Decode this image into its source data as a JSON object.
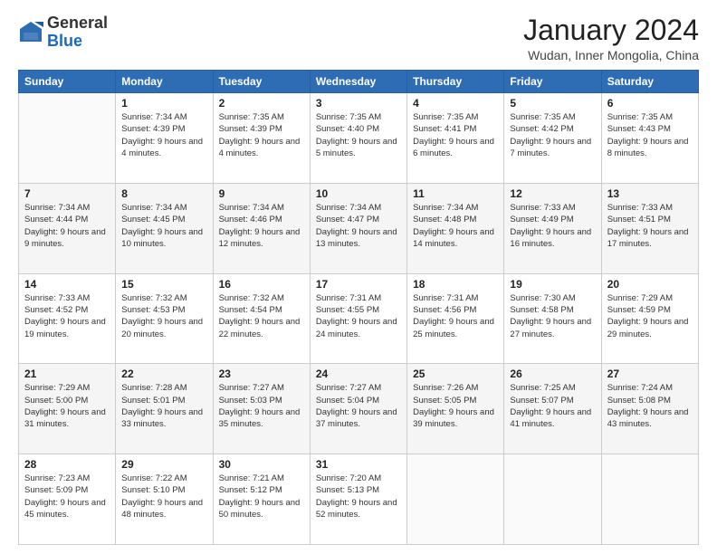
{
  "logo": {
    "general": "General",
    "blue": "Blue"
  },
  "header": {
    "month": "January 2024",
    "location": "Wudan, Inner Mongolia, China"
  },
  "weekdays": [
    "Sunday",
    "Monday",
    "Tuesday",
    "Wednesday",
    "Thursday",
    "Friday",
    "Saturday"
  ],
  "weeks": [
    [
      {
        "day": "",
        "sunrise": "",
        "sunset": "",
        "daylight": ""
      },
      {
        "day": "1",
        "sunrise": "Sunrise: 7:34 AM",
        "sunset": "Sunset: 4:39 PM",
        "daylight": "Daylight: 9 hours and 4 minutes."
      },
      {
        "day": "2",
        "sunrise": "Sunrise: 7:35 AM",
        "sunset": "Sunset: 4:39 PM",
        "daylight": "Daylight: 9 hours and 4 minutes."
      },
      {
        "day": "3",
        "sunrise": "Sunrise: 7:35 AM",
        "sunset": "Sunset: 4:40 PM",
        "daylight": "Daylight: 9 hours and 5 minutes."
      },
      {
        "day": "4",
        "sunrise": "Sunrise: 7:35 AM",
        "sunset": "Sunset: 4:41 PM",
        "daylight": "Daylight: 9 hours and 6 minutes."
      },
      {
        "day": "5",
        "sunrise": "Sunrise: 7:35 AM",
        "sunset": "Sunset: 4:42 PM",
        "daylight": "Daylight: 9 hours and 7 minutes."
      },
      {
        "day": "6",
        "sunrise": "Sunrise: 7:35 AM",
        "sunset": "Sunset: 4:43 PM",
        "daylight": "Daylight: 9 hours and 8 minutes."
      }
    ],
    [
      {
        "day": "7",
        "sunrise": "Sunrise: 7:34 AM",
        "sunset": "Sunset: 4:44 PM",
        "daylight": "Daylight: 9 hours and 9 minutes."
      },
      {
        "day": "8",
        "sunrise": "Sunrise: 7:34 AM",
        "sunset": "Sunset: 4:45 PM",
        "daylight": "Daylight: 9 hours and 10 minutes."
      },
      {
        "day": "9",
        "sunrise": "Sunrise: 7:34 AM",
        "sunset": "Sunset: 4:46 PM",
        "daylight": "Daylight: 9 hours and 12 minutes."
      },
      {
        "day": "10",
        "sunrise": "Sunrise: 7:34 AM",
        "sunset": "Sunset: 4:47 PM",
        "daylight": "Daylight: 9 hours and 13 minutes."
      },
      {
        "day": "11",
        "sunrise": "Sunrise: 7:34 AM",
        "sunset": "Sunset: 4:48 PM",
        "daylight": "Daylight: 9 hours and 14 minutes."
      },
      {
        "day": "12",
        "sunrise": "Sunrise: 7:33 AM",
        "sunset": "Sunset: 4:49 PM",
        "daylight": "Daylight: 9 hours and 16 minutes."
      },
      {
        "day": "13",
        "sunrise": "Sunrise: 7:33 AM",
        "sunset": "Sunset: 4:51 PM",
        "daylight": "Daylight: 9 hours and 17 minutes."
      }
    ],
    [
      {
        "day": "14",
        "sunrise": "Sunrise: 7:33 AM",
        "sunset": "Sunset: 4:52 PM",
        "daylight": "Daylight: 9 hours and 19 minutes."
      },
      {
        "day": "15",
        "sunrise": "Sunrise: 7:32 AM",
        "sunset": "Sunset: 4:53 PM",
        "daylight": "Daylight: 9 hours and 20 minutes."
      },
      {
        "day": "16",
        "sunrise": "Sunrise: 7:32 AM",
        "sunset": "Sunset: 4:54 PM",
        "daylight": "Daylight: 9 hours and 22 minutes."
      },
      {
        "day": "17",
        "sunrise": "Sunrise: 7:31 AM",
        "sunset": "Sunset: 4:55 PM",
        "daylight": "Daylight: 9 hours and 24 minutes."
      },
      {
        "day": "18",
        "sunrise": "Sunrise: 7:31 AM",
        "sunset": "Sunset: 4:56 PM",
        "daylight": "Daylight: 9 hours and 25 minutes."
      },
      {
        "day": "19",
        "sunrise": "Sunrise: 7:30 AM",
        "sunset": "Sunset: 4:58 PM",
        "daylight": "Daylight: 9 hours and 27 minutes."
      },
      {
        "day": "20",
        "sunrise": "Sunrise: 7:29 AM",
        "sunset": "Sunset: 4:59 PM",
        "daylight": "Daylight: 9 hours and 29 minutes."
      }
    ],
    [
      {
        "day": "21",
        "sunrise": "Sunrise: 7:29 AM",
        "sunset": "Sunset: 5:00 PM",
        "daylight": "Daylight: 9 hours and 31 minutes."
      },
      {
        "day": "22",
        "sunrise": "Sunrise: 7:28 AM",
        "sunset": "Sunset: 5:01 PM",
        "daylight": "Daylight: 9 hours and 33 minutes."
      },
      {
        "day": "23",
        "sunrise": "Sunrise: 7:27 AM",
        "sunset": "Sunset: 5:03 PM",
        "daylight": "Daylight: 9 hours and 35 minutes."
      },
      {
        "day": "24",
        "sunrise": "Sunrise: 7:27 AM",
        "sunset": "Sunset: 5:04 PM",
        "daylight": "Daylight: 9 hours and 37 minutes."
      },
      {
        "day": "25",
        "sunrise": "Sunrise: 7:26 AM",
        "sunset": "Sunset: 5:05 PM",
        "daylight": "Daylight: 9 hours and 39 minutes."
      },
      {
        "day": "26",
        "sunrise": "Sunrise: 7:25 AM",
        "sunset": "Sunset: 5:07 PM",
        "daylight": "Daylight: 9 hours and 41 minutes."
      },
      {
        "day": "27",
        "sunrise": "Sunrise: 7:24 AM",
        "sunset": "Sunset: 5:08 PM",
        "daylight": "Daylight: 9 hours and 43 minutes."
      }
    ],
    [
      {
        "day": "28",
        "sunrise": "Sunrise: 7:23 AM",
        "sunset": "Sunset: 5:09 PM",
        "daylight": "Daylight: 9 hours and 45 minutes."
      },
      {
        "day": "29",
        "sunrise": "Sunrise: 7:22 AM",
        "sunset": "Sunset: 5:10 PM",
        "daylight": "Daylight: 9 hours and 48 minutes."
      },
      {
        "day": "30",
        "sunrise": "Sunrise: 7:21 AM",
        "sunset": "Sunset: 5:12 PM",
        "daylight": "Daylight: 9 hours and 50 minutes."
      },
      {
        "day": "31",
        "sunrise": "Sunrise: 7:20 AM",
        "sunset": "Sunset: 5:13 PM",
        "daylight": "Daylight: 9 hours and 52 minutes."
      },
      {
        "day": "",
        "sunrise": "",
        "sunset": "",
        "daylight": ""
      },
      {
        "day": "",
        "sunrise": "",
        "sunset": "",
        "daylight": ""
      },
      {
        "day": "",
        "sunrise": "",
        "sunset": "",
        "daylight": ""
      }
    ]
  ]
}
